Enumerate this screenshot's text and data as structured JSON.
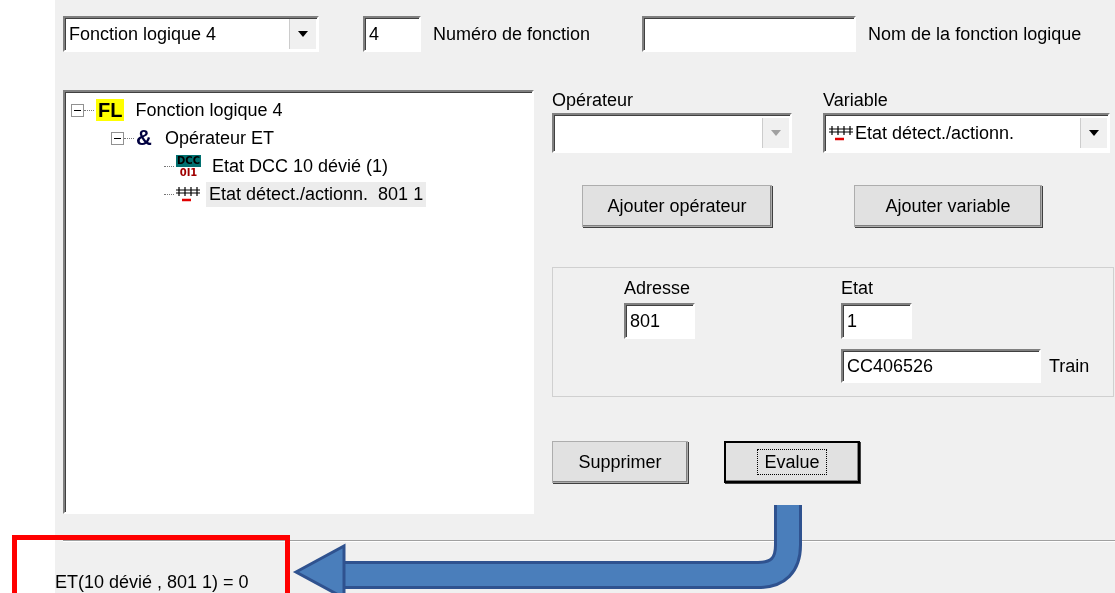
{
  "header": {
    "function_select": {
      "value": "Fonction logique 4"
    },
    "function_number": {
      "value": "4",
      "label": "Numéro de fonction"
    },
    "function_name": {
      "label": "Nom de la fonction logique"
    }
  },
  "tree": [
    {
      "kind": "function",
      "icon_text": [
        "FL"
      ],
      "label": "Fonction logique 4",
      "expanded": true,
      "selected": false,
      "children": [
        {
          "kind": "operator",
          "icon_text": [
            "&"
          ],
          "label": "Opérateur ET",
          "expanded": true,
          "selected": false,
          "children": [
            {
              "kind": "dcc",
              "icon_text": [
                "DCC",
                "0I1"
              ],
              "label": "Etat DCC 10 dévié (1)",
              "selected": false
            },
            {
              "kind": "detector",
              "label": "Etat détect./actionn.  801 1",
              "selected": true
            }
          ]
        }
      ]
    }
  ],
  "operator": {
    "label": "Opérateur",
    "disabled": true
  },
  "variable": {
    "label": "Variable",
    "value": "Etat détect./actionn.",
    "kind": "detector"
  },
  "add_buttons": [
    "Ajouter opérateur",
    "Ajouter variable"
  ],
  "group": {
    "address_label": "Adresse",
    "address": "801",
    "state_label": "Etat",
    "state": "1",
    "train": "CC406526",
    "train_label": "Train"
  },
  "actions": [
    {
      "label": "Supprimer",
      "focused": false
    },
    {
      "label": "Evalue",
      "focused": true
    }
  ],
  "result": "ET(10 dévié , 801 1) = 0"
}
